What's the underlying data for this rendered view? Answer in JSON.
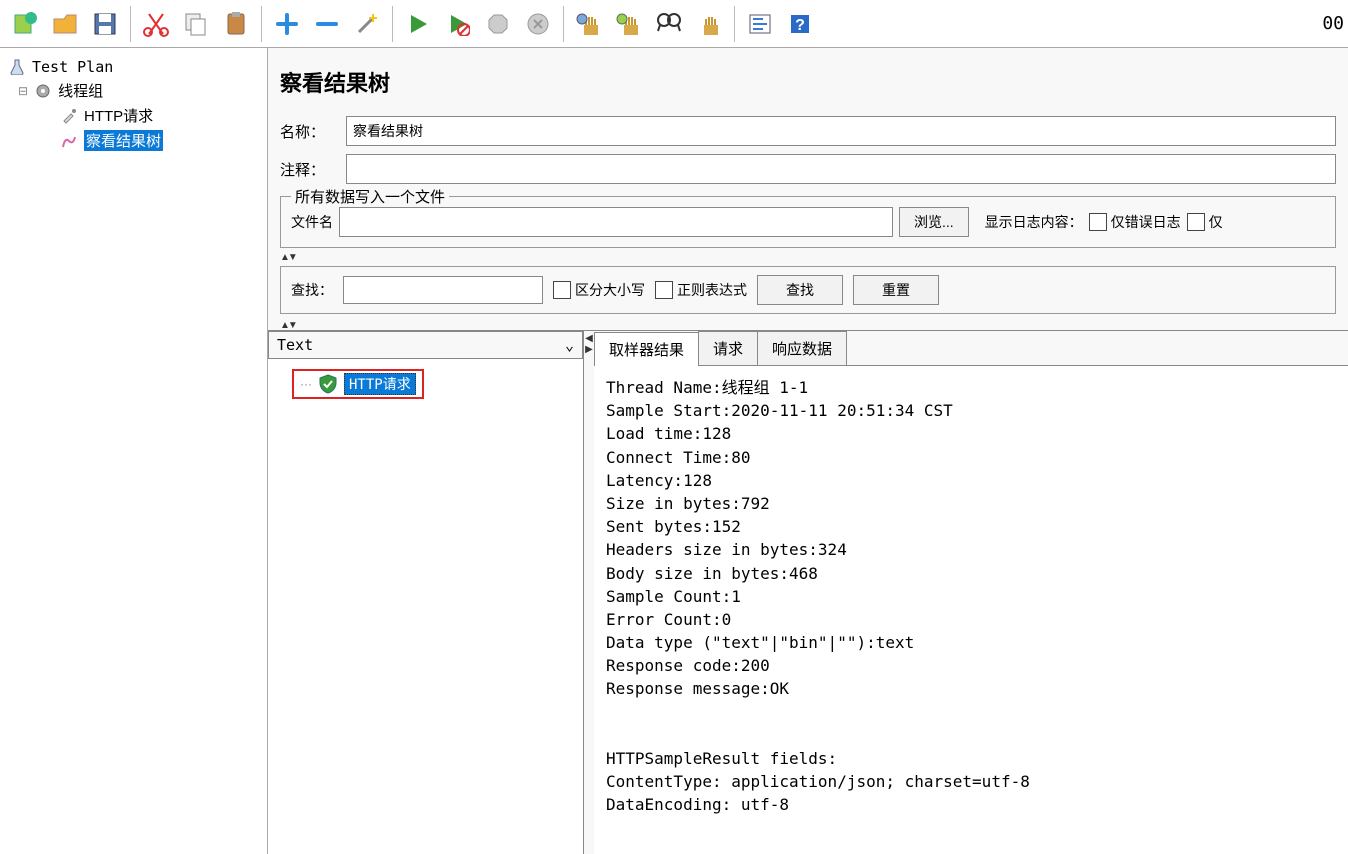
{
  "toolbar": {
    "counter": "00"
  },
  "tree": {
    "test_plan": "Test Plan",
    "thread_group": "线程组",
    "http_request": "HTTP请求",
    "view_results": "察看结果树"
  },
  "panel": {
    "title": "察看结果树",
    "name_label": "名称：",
    "name_value": "察看结果树",
    "comment_label": "注释：",
    "comment_value": ""
  },
  "file_section": {
    "legend": "所有数据写入一个文件",
    "filename_label": "文件名",
    "filename_value": "",
    "browse_button": "浏览...",
    "show_log_label": "显示日志内容：",
    "errors_only": "仅错误日志",
    "partial": "仅"
  },
  "find": {
    "label": "查找：",
    "value": "",
    "case_sensitive": "区分大小写",
    "regex": "正则表达式",
    "find_button": "查找",
    "reset_button": "重置"
  },
  "results": {
    "select_value": "Text",
    "result_label": "HTTP请求"
  },
  "tabs": {
    "sampler": "取样器结果",
    "request": "请求",
    "response": "响应数据"
  },
  "details": {
    "thread_name": "Thread Name:线程组 1-1",
    "sample_start": "Sample Start:2020-11-11 20:51:34 CST",
    "load_time": "Load time:128",
    "connect_time": "Connect Time:80",
    "latency": "Latency:128",
    "size_bytes": "Size in bytes:792",
    "sent_bytes": "Sent bytes:152",
    "headers_size": "Headers size in bytes:324",
    "body_size": "Body size in bytes:468",
    "sample_count": "Sample Count:1",
    "error_count": "Error Count:0",
    "data_type": "Data type (\"text\"|\"bin\"|\"\"):text",
    "response_code": "Response code:200",
    "response_msg": "Response message:OK",
    "blank": "",
    "fields_header": "HTTPSampleResult fields:",
    "content_type": "ContentType: application/json; charset=utf-8",
    "data_encoding": "DataEncoding: utf-8"
  }
}
